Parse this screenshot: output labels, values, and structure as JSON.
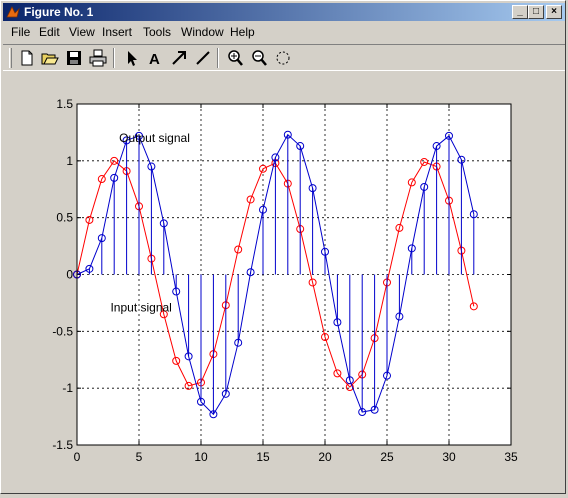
{
  "window": {
    "title": "Figure No. 1",
    "minimize": "_",
    "maximize": "□",
    "close": "×"
  },
  "menu": [
    "File",
    "Edit",
    "View",
    "Insert",
    "Tools",
    "Window",
    "Help"
  ],
  "toolbar": [
    {
      "name": "new-figure-icon"
    },
    {
      "name": "open-icon"
    },
    {
      "name": "save-icon"
    },
    {
      "name": "print-icon"
    },
    {
      "name": "select-arrow-icon"
    },
    {
      "name": "insert-text-icon"
    },
    {
      "name": "insert-arrow-icon"
    },
    {
      "name": "insert-line-icon"
    },
    {
      "name": "zoom-in-icon"
    },
    {
      "name": "zoom-out-icon"
    },
    {
      "name": "rotate-icon"
    }
  ],
  "chart_data": {
    "type": "line",
    "xlim": [
      0,
      35
    ],
    "ylim": [
      -1.5,
      1.5
    ],
    "xticks": [
      "0",
      "5",
      "10",
      "15",
      "20",
      "25",
      "30",
      "35"
    ],
    "yticks": [
      "1.5",
      "1",
      "0.5",
      "0",
      "-0.5",
      "-1",
      "-1.5"
    ],
    "grid": true,
    "annotations": [
      {
        "text": "Output signal",
        "x": 3.4,
        "y": 1.2
      },
      {
        "text": "Input signal",
        "x": 2.7,
        "y": -0.29
      }
    ],
    "series": [
      {
        "color": "#ff0000",
        "x": [
          0,
          1,
          2,
          3,
          4,
          5,
          6,
          7,
          8,
          9,
          10,
          11,
          12,
          13,
          14,
          15,
          16,
          17,
          18,
          19,
          20,
          21,
          22,
          23,
          24,
          25,
          26,
          27,
          28,
          29,
          30,
          31,
          32
        ],
        "y": [
          0,
          0.48,
          0.84,
          1.0,
          0.91,
          0.6,
          0.14,
          -0.35,
          -0.76,
          -0.98,
          -0.95,
          -0.7,
          -0.27,
          0.22,
          0.66,
          0.93,
          0.98,
          0.8,
          0.4,
          -0.07,
          -0.55,
          -0.87,
          -0.99,
          -0.88,
          -0.56,
          -0.07,
          0.41,
          0.81,
          0.99,
          0.95,
          0.65,
          0.21,
          -0.28
        ],
        "stem": false
      },
      {
        "color": "#0000cc",
        "x": [
          0,
          1,
          2,
          3,
          4,
          5,
          6,
          7,
          8,
          9,
          10,
          11,
          12,
          13,
          14,
          15,
          16,
          17,
          18,
          19,
          20,
          21,
          22,
          23,
          24,
          25,
          26,
          27,
          28,
          29,
          30,
          31,
          32
        ],
        "y": [
          0,
          0.05,
          0.32,
          0.85,
          1.18,
          1.22,
          0.95,
          0.45,
          -0.15,
          -0.72,
          -1.12,
          -1.23,
          -1.05,
          -0.6,
          0.02,
          0.57,
          1.03,
          1.23,
          1.13,
          0.76,
          0.2,
          -0.42,
          -0.93,
          -1.21,
          -1.19,
          -0.89,
          -0.37,
          0.23,
          0.77,
          1.13,
          1.22,
          1.01,
          0.53
        ],
        "stem": true
      }
    ]
  }
}
